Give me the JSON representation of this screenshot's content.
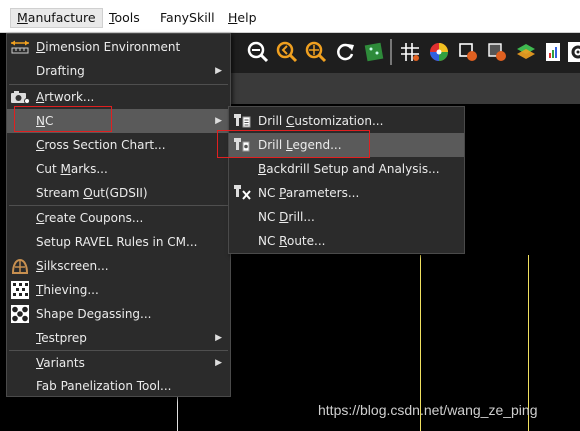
{
  "menubar": {
    "items": [
      {
        "label_u": "M",
        "label_rest": "anufacture"
      },
      {
        "label_u": "T",
        "label_rest": "ools"
      },
      {
        "label_u": "",
        "label_rest": "FanySkill"
      },
      {
        "label_u": "H",
        "label_rest": "elp"
      }
    ]
  },
  "manufacture_menu": {
    "items": [
      {
        "pre": "",
        "u": "D",
        "post": "imension Environment",
        "icon": "dimension-icon"
      },
      {
        "pre": "Drafting",
        "u": "",
        "post": "",
        "icon": "",
        "submenu": true
      },
      {
        "pre": "",
        "u": "A",
        "post": "rtwork...",
        "icon": "camera-icon"
      },
      {
        "pre": "",
        "u": "N",
        "post": "C",
        "icon": "",
        "submenu": true
      },
      {
        "pre": "",
        "u": "C",
        "post": "ross Section Chart...",
        "icon": ""
      },
      {
        "pre": "Cut ",
        "u": "M",
        "post": "arks...",
        "icon": ""
      },
      {
        "pre": "Stream ",
        "u": "O",
        "post": "ut(GDSII)",
        "icon": ""
      },
      {
        "pre": "",
        "u": "C",
        "post": "reate Coupons...",
        "icon": ""
      },
      {
        "pre": "Setup RAVEL Rules in CM...",
        "u": "",
        "post": "",
        "icon": ""
      },
      {
        "pre": "",
        "u": "S",
        "post": "ilkscreen...",
        "icon": "silkscreen-icon"
      },
      {
        "pre": "",
        "u": "T",
        "post": "hieving...",
        "icon": "thieving-icon"
      },
      {
        "pre": "Shape Degassing...",
        "u": "",
        "post": "",
        "icon": "degassing-icon"
      },
      {
        "pre": "",
        "u": "T",
        "post": "estprep",
        "icon": "",
        "submenu": true
      },
      {
        "pre": "",
        "u": "V",
        "post": "ariants",
        "icon": "",
        "submenu": true
      },
      {
        "pre": "Fab Panelization Tool...",
        "u": "",
        "post": "",
        "icon": ""
      }
    ]
  },
  "nc_submenu": {
    "items": [
      {
        "pre": "Drill ",
        "u": "C",
        "post": "ustomization...",
        "icon": "drill-customization-icon"
      },
      {
        "pre": "Drill ",
        "u": "L",
        "post": "egend...",
        "icon": "drill-legend-icon"
      },
      {
        "pre": "",
        "u": "B",
        "post": "ackdrill Setup and Analysis...",
        "icon": ""
      },
      {
        "pre": "NC ",
        "u": "P",
        "post": "arameters...",
        "icon": "nc-parameters-icon"
      },
      {
        "pre": "NC ",
        "u": "D",
        "post": "rill...",
        "icon": ""
      },
      {
        "pre": "NC ",
        "u": "R",
        "post": "oute...",
        "icon": ""
      }
    ]
  },
  "watermark": "https://blog.csdn.net/wang_ze_ping",
  "colors": {
    "menu_bg": "#2b2b2b",
    "highlight": "#5a5a5a",
    "annotation_red": "#e02020",
    "canvas_line_yellow": "#f0e060"
  }
}
